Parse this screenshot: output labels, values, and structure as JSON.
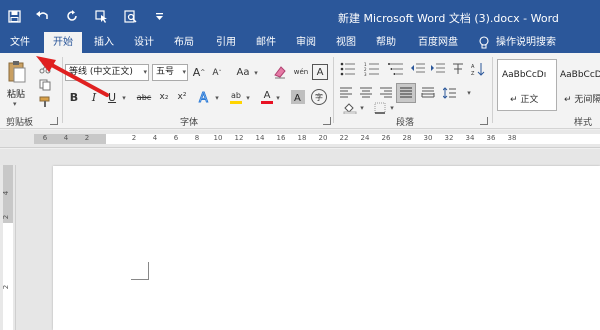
{
  "titlebar": {
    "title": "新建 Microsoft Word 文档 (3).docx  -  Word"
  },
  "qat": {
    "icons": [
      "save-icon",
      "undo-icon",
      "redo-icon",
      "touch-mode-icon",
      "print-preview-icon",
      "customize-icon"
    ]
  },
  "tabs": [
    {
      "label": "文件"
    },
    {
      "label": "开始"
    },
    {
      "label": "插入"
    },
    {
      "label": "设计"
    },
    {
      "label": "布局"
    },
    {
      "label": "引用"
    },
    {
      "label": "邮件"
    },
    {
      "label": "审阅"
    },
    {
      "label": "视图"
    },
    {
      "label": "帮助"
    },
    {
      "label": "百度网盘"
    },
    {
      "label": "操作说明搜索"
    }
  ],
  "active_tab": "开始",
  "ribbon": {
    "clipboard": {
      "paste_label": "粘贴",
      "group_label": "剪贴板"
    },
    "font": {
      "font_name": "等线 (中文正文)",
      "font_size": "五号",
      "group_label": "字体",
      "bold": "B",
      "italic": "I",
      "underline": "U",
      "strike": "abc",
      "subscript": "x₂",
      "superscript": "x²",
      "grow": "A",
      "shrink": "A",
      "case": "Aa",
      "phonetic": "wén",
      "char_border": "A",
      "font_color_label": "A",
      "highlight_label": "ab",
      "circle_char": "字"
    },
    "paragraph": {
      "group_label": "段落"
    },
    "styles": {
      "group_label": "样式",
      "items": [
        {
          "sample": "AaBbCcDı",
          "name": "↵ 正文"
        },
        {
          "sample": "AaBbCcDı",
          "name": "↵ 无间隔"
        }
      ]
    }
  },
  "ruler": {
    "ticks": [
      "6",
      "4",
      "2",
      "2",
      "4",
      "6",
      "8",
      "10",
      "12",
      "14",
      "16",
      "18",
      "20",
      "22",
      "24",
      "26",
      "28",
      "30",
      "32",
      "34",
      "36",
      "38"
    ]
  },
  "vruler": {
    "ticks": [
      "4",
      "2",
      "2"
    ]
  },
  "colors": {
    "brand": "#2b579a",
    "font_color": "#e81123",
    "highlight": "#ffd400",
    "annotation_arrow": "#e02020"
  }
}
